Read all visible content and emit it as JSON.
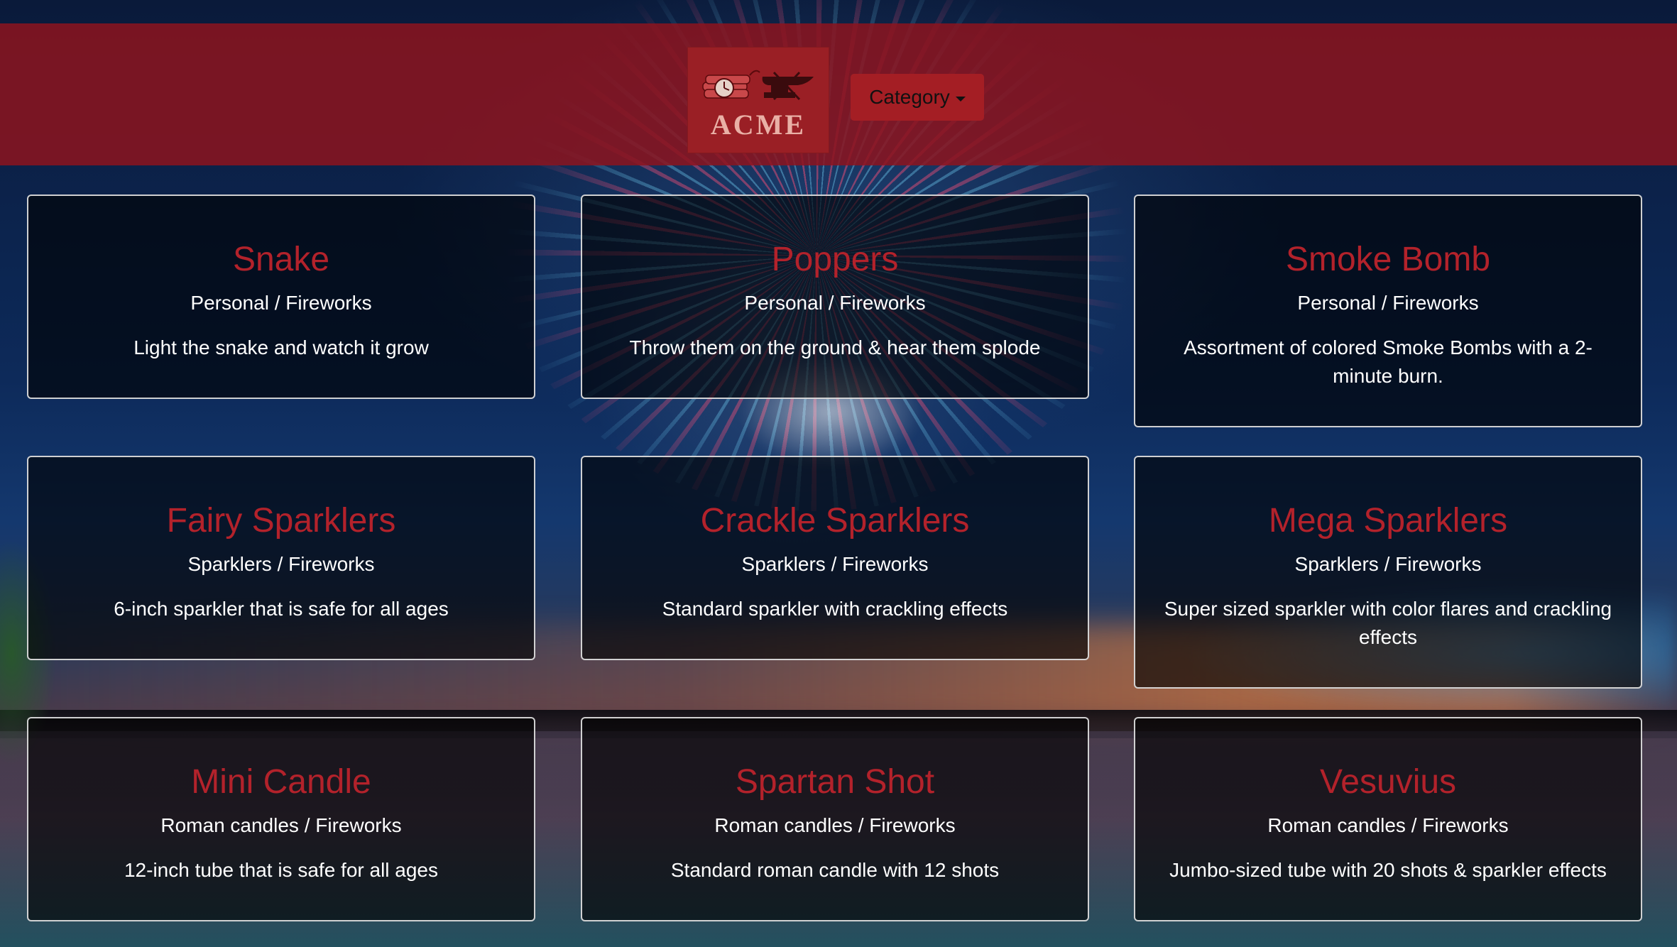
{
  "header": {
    "logo_text": "ACME",
    "category_button": "Category"
  },
  "products": [
    {
      "title": "Snake",
      "category": "Personal / Fireworks",
      "description": "Light the snake and watch it grow"
    },
    {
      "title": "Poppers",
      "category": "Personal / Fireworks",
      "description": "Throw them on the ground & hear them splode"
    },
    {
      "title": "Smoke Bomb",
      "category": "Personal / Fireworks",
      "description": "Assortment of colored Smoke Bombs with a 2-minute burn."
    },
    {
      "title": "Fairy Sparklers",
      "category": "Sparklers / Fireworks",
      "description": "6-inch sparkler that is safe for all ages"
    },
    {
      "title": "Crackle Sparklers",
      "category": "Sparklers / Fireworks",
      "description": "Standard sparkler with crackling effects"
    },
    {
      "title": "Mega Sparklers",
      "category": "Sparklers / Fireworks",
      "description": "Super sized sparkler with color flares and crackling effects"
    },
    {
      "title": "Mini Candle",
      "category": "Roman candles / Fireworks",
      "description": "12-inch tube that is safe for all ages"
    },
    {
      "title": "Spartan Shot",
      "category": "Roman candles / Fireworks",
      "description": "Standard roman candle with 12 shots"
    },
    {
      "title": "Vesuvius",
      "category": "Roman candles / Fireworks",
      "description": "Jumbo-sized tube with 20 shots & sparkler effects"
    }
  ]
}
